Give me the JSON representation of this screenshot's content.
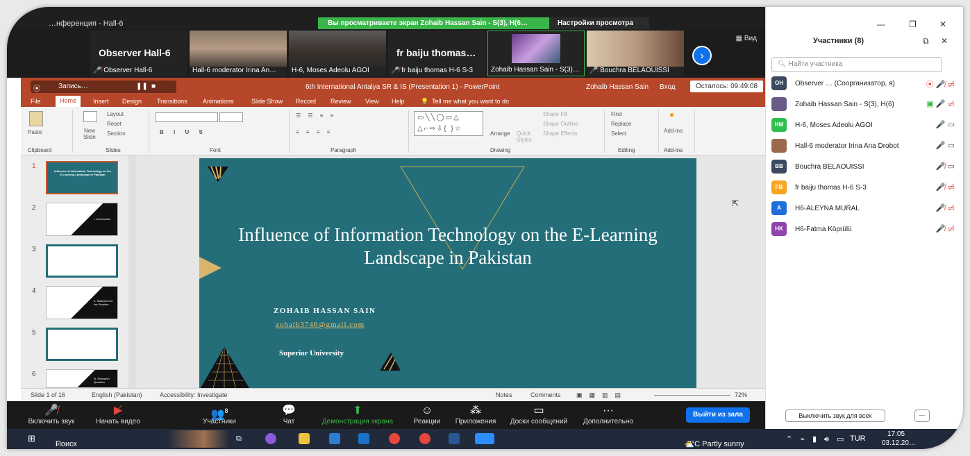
{
  "zoom": {
    "window_title": "…нференция - Hall-6",
    "share_banner": "Вы просматриваете экран Zohaib Hassan Sain - S(3), H(6…",
    "view_options": "Настройки просмотра",
    "view_label": "Вид",
    "tiles": [
      {
        "big": "Observer  Hall-6",
        "name": "Observer  Hall-6",
        "muted": true
      },
      {
        "big": "",
        "name": "Hall-6 moderator Irina An…",
        "muted": false
      },
      {
        "big": "",
        "name": "H-6, Moses Adeolu AGOI",
        "muted": false
      },
      {
        "big": "fr  baiju thomas…",
        "name": "fr  baiju thomas H-6 S-3",
        "muted": true
      },
      {
        "big": "",
        "name": "Zohaib Hassan Sain - S(3)…",
        "muted": false
      },
      {
        "big": "",
        "name": "Bouchra BELAOUISSI",
        "muted": true
      }
    ],
    "toolbar": {
      "unmute": "Включить звук",
      "start_video": "Начать видео",
      "participants": "Участники",
      "participants_count": "8",
      "chat": "Чат",
      "share": "Демонстрация экрана",
      "reactions": "Реакции",
      "apps": "Приложения",
      "whiteboards": "Доски сообщений",
      "more": "Дополнительно",
      "leave": "Выйти из зала"
    }
  },
  "powerpoint": {
    "recording": "Запись…",
    "title": "6th International Antalya SR & IS (Presentation 1)  -  PowerPoint",
    "author": "Zohaib Hassan Sain",
    "login": "Вход",
    "time_left": "Осталось: 09:49:08",
    "tabs": [
      "File",
      "Home",
      "Insert",
      "Design",
      "Transitions",
      "Animations",
      "Slide Show",
      "Record",
      "Review",
      "View",
      "Help",
      "Tell me what you want to do"
    ],
    "ribbon": {
      "paste": "Paste",
      "clipboard": "Clipboard",
      "new_slide": "New Slide",
      "layout": "Layout",
      "reset": "Reset",
      "section": "Section",
      "slides": "Slides",
      "font": "Font",
      "paragraph": "Paragraph",
      "arrange": "Arrange",
      "quick_styles": "Quick Styles",
      "shape_fill": "Shape Fill",
      "shape_outline": "Shape Outline",
      "shape_effects": "Shape Effects",
      "drawing": "Drawing",
      "find": "Find",
      "replace": "Replace",
      "select": "Select",
      "editing": "Editing",
      "addins": "Add-ins",
      "addins_group": "Add-ins"
    },
    "thumbnails": [
      {
        "num": "1",
        "text": "Influence of Information Technology on the E-Learning Landscape in Pakistan"
      },
      {
        "num": "2",
        "text": "I. Introduction"
      },
      {
        "num": "3",
        "text": ""
      },
      {
        "num": "4",
        "text": "II. Statement of the Problem"
      },
      {
        "num": "5",
        "text": ""
      },
      {
        "num": "6",
        "text": "III. Research Question"
      }
    ],
    "slide": {
      "title": "Influence of Information Technology on the E-Learning Landscape in Pakistan",
      "author": "ZOHAIB HASSAN SAIN",
      "email": "zohaib3746@gmail.com",
      "university": "Superior University"
    },
    "status": {
      "slide_of": "Slide 1 of 16",
      "language": "English (Pakistan)",
      "accessibility": "Accessibility: Investigate",
      "notes": "Notes",
      "comments": "Comments",
      "zoom": "72%"
    }
  },
  "participants": {
    "title": "Участники (8)",
    "search_placeholder": "Найти участника",
    "list": [
      {
        "initials": "OH",
        "color": "#3b4a5e",
        "name": "Observer … (Соорганизатор, я)",
        "mic": "muted",
        "cam": "off",
        "extra": "rec"
      },
      {
        "initials": "",
        "color": "#6a5a8a",
        "name": "Zohaib Hassan Sain - S(3), H(6)",
        "mic": "on",
        "cam": "off",
        "extra": "share"
      },
      {
        "initials": "HM",
        "color": "#2fbf4f",
        "name": "H-6, Moses Adeolu AGOI",
        "mic": "on",
        "cam": "on",
        "extra": ""
      },
      {
        "initials": "",
        "color": "#9a6a4a",
        "name": "Hall-6 moderator Irina Ana Drobot",
        "mic": "on",
        "cam": "on",
        "extra": ""
      },
      {
        "initials": "BB",
        "color": "#3b4a5e",
        "name": "Bouchra BELAOUISSI",
        "mic": "muted",
        "cam": "on",
        "extra": ""
      },
      {
        "initials": "FB",
        "color": "#f5a623",
        "name": "fr  baiju thomas H-6 S-3",
        "mic": "muted",
        "cam": "off",
        "extra": ""
      },
      {
        "initials": "A",
        "color": "#1e6fd9",
        "name": "H6-ALEYNA MURAL",
        "mic": "muted",
        "cam": "off",
        "extra": ""
      },
      {
        "initials": "HK",
        "color": "#8e44ad",
        "name": "H6-Fatma Köprülü",
        "mic": "muted",
        "cam": "off",
        "extra": ""
      }
    ],
    "mute_all": "Выключить звук для всех",
    "more": "···"
  },
  "taskbar": {
    "search": "Поиск",
    "weather": "-7°C  Partly sunny",
    "lang": "TUR",
    "time": "17:05",
    "date": "03.12.20…"
  }
}
